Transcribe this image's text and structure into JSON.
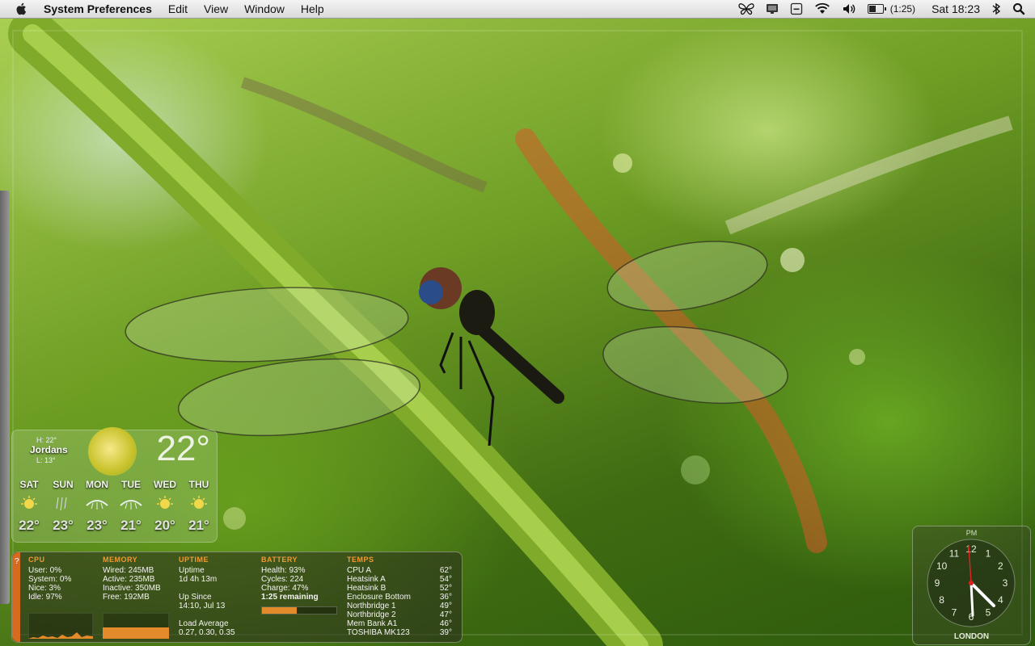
{
  "menubar": {
    "app": "System Preferences",
    "items": [
      "Edit",
      "View",
      "Window",
      "Help"
    ],
    "battery_time": "(1:25)",
    "battery_level": 0.47,
    "clock": "Sat 18:23"
  },
  "weather": {
    "high": "H: 22°",
    "low": "L: 13°",
    "city": "Jordans",
    "temp": "22°",
    "days": [
      {
        "day": "SAT",
        "icon": "sun-icon",
        "temp": "22°"
      },
      {
        "day": "SUN",
        "icon": "rain-icon",
        "temp": "23°"
      },
      {
        "day": "MON",
        "icon": "cloud-icon",
        "temp": "23°"
      },
      {
        "day": "TUE",
        "icon": "cloud-icon",
        "temp": "21°"
      },
      {
        "day": "WED",
        "icon": "sun-icon",
        "temp": "20°"
      },
      {
        "day": "THU",
        "icon": "sun-icon",
        "temp": "21°"
      }
    ]
  },
  "istat": {
    "cpu": {
      "title": "CPU",
      "user": "User: 0%",
      "system": "System: 0%",
      "nice": "Nice: 3%",
      "idle": "Idle: 97%"
    },
    "memory": {
      "title": "MEMORY",
      "wired": "Wired: 245MB",
      "active": "Active: 235MB",
      "inactive": "Inactive: 350MB",
      "free": "Free: 192MB"
    },
    "uptime": {
      "title": "UPTIME",
      "label": "Uptime",
      "value": "1d 4h 13m",
      "since_label": "Up Since",
      "since": "14:10, Jul 13",
      "load_label": "Load Average",
      "load": "0.27, 0.30, 0.35"
    },
    "battery": {
      "title": "BATTERY",
      "health": "Health: 93%",
      "cycles": "Cycles: 224",
      "charge": "Charge: 47%",
      "remaining": "1:25 remaining",
      "charge_level": 0.47
    },
    "temps": {
      "title": "TEMPS",
      "rows": [
        {
          "name": "CPU A",
          "value": "62°"
        },
        {
          "name": "Heatsink A",
          "value": "54°"
        },
        {
          "name": "Heatsink B",
          "value": "52°"
        },
        {
          "name": "Enclosure Bottom",
          "value": "36°"
        },
        {
          "name": "Northbridge 1",
          "value": "49°"
        },
        {
          "name": "Northbridge 2",
          "value": "47°"
        },
        {
          "name": "Mem Bank A1",
          "value": "46°"
        },
        {
          "name": "TOSHIBA MK123",
          "value": "39°"
        }
      ]
    }
  },
  "clock": {
    "period": "PM",
    "city": "LONDON",
    "numbers": [
      "12",
      "1",
      "2",
      "3",
      "4",
      "5",
      "6",
      "7",
      "8",
      "9",
      "10",
      "11"
    ]
  }
}
